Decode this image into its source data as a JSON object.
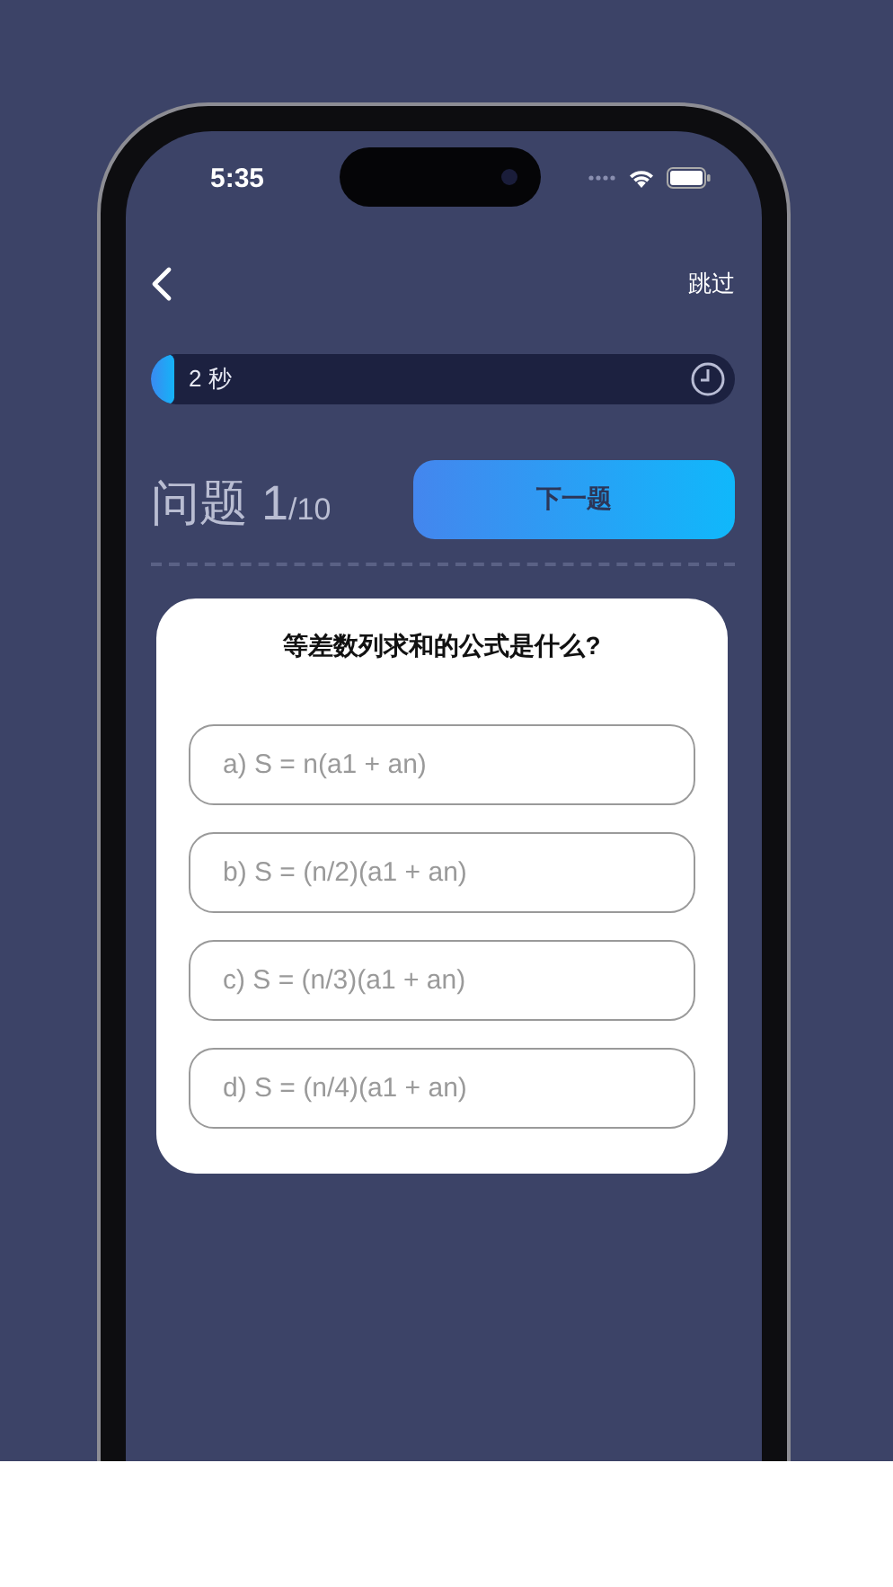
{
  "status_bar": {
    "time": "5:35"
  },
  "header": {
    "skip": "跳过"
  },
  "timer": {
    "label": "2 秒",
    "level": 0.04
  },
  "progress": {
    "label": "问题 1",
    "total": "/10"
  },
  "next_button": "下一题",
  "question": "等差数列求和的公式是什么?",
  "options": [
    {
      "label": "a) S = n(a1 + an)"
    },
    {
      "label": "b) S = (n/2)(a1 + an)"
    },
    {
      "label": "c) S = (n/3)(a1 + an)"
    },
    {
      "label": "d) S = (n/4)(a1 + an)"
    }
  ]
}
